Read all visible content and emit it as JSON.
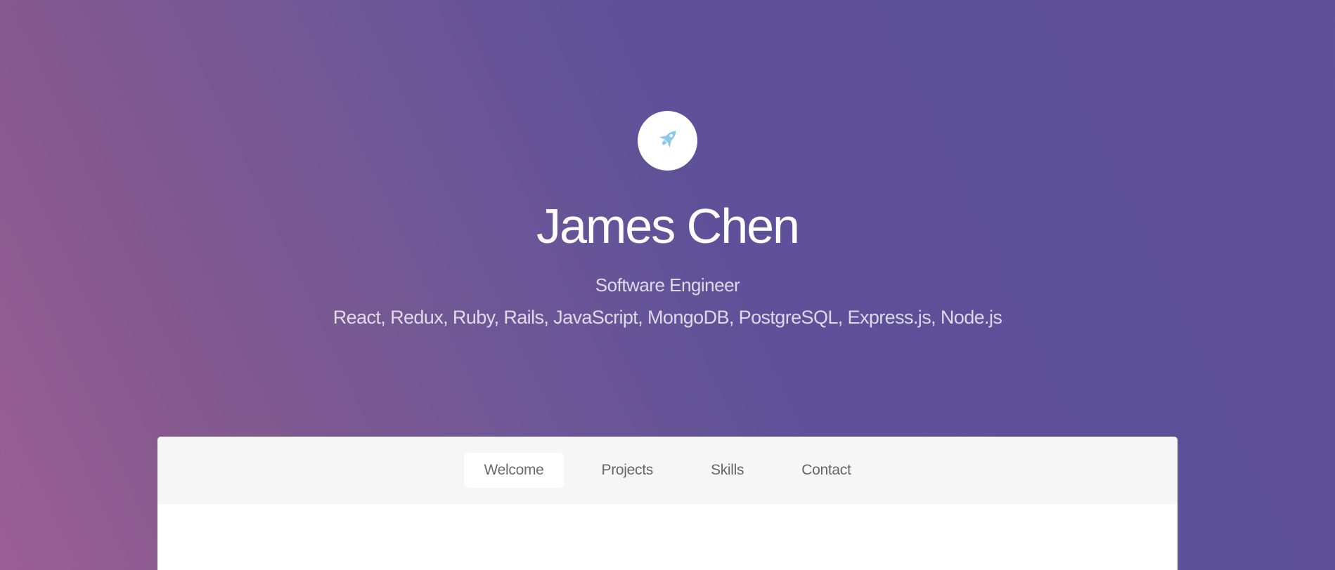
{
  "header": {
    "logo_icon": "rocket-icon",
    "name": "James Chen",
    "role": "Software Engineer",
    "skills": "React, Redux, Ruby, Rails, JavaScript, MongoDB, PostgreSQL, Express.js, Node.js"
  },
  "nav": {
    "items": [
      {
        "label": "Welcome",
        "active": true
      },
      {
        "label": "Projects",
        "active": false
      },
      {
        "label": "Skills",
        "active": false
      },
      {
        "label": "Contact",
        "active": false
      }
    ]
  },
  "colors": {
    "accent": "#8cc9e8",
    "gradient_start": "#9a5f94",
    "gradient_end": "#5c5098"
  }
}
